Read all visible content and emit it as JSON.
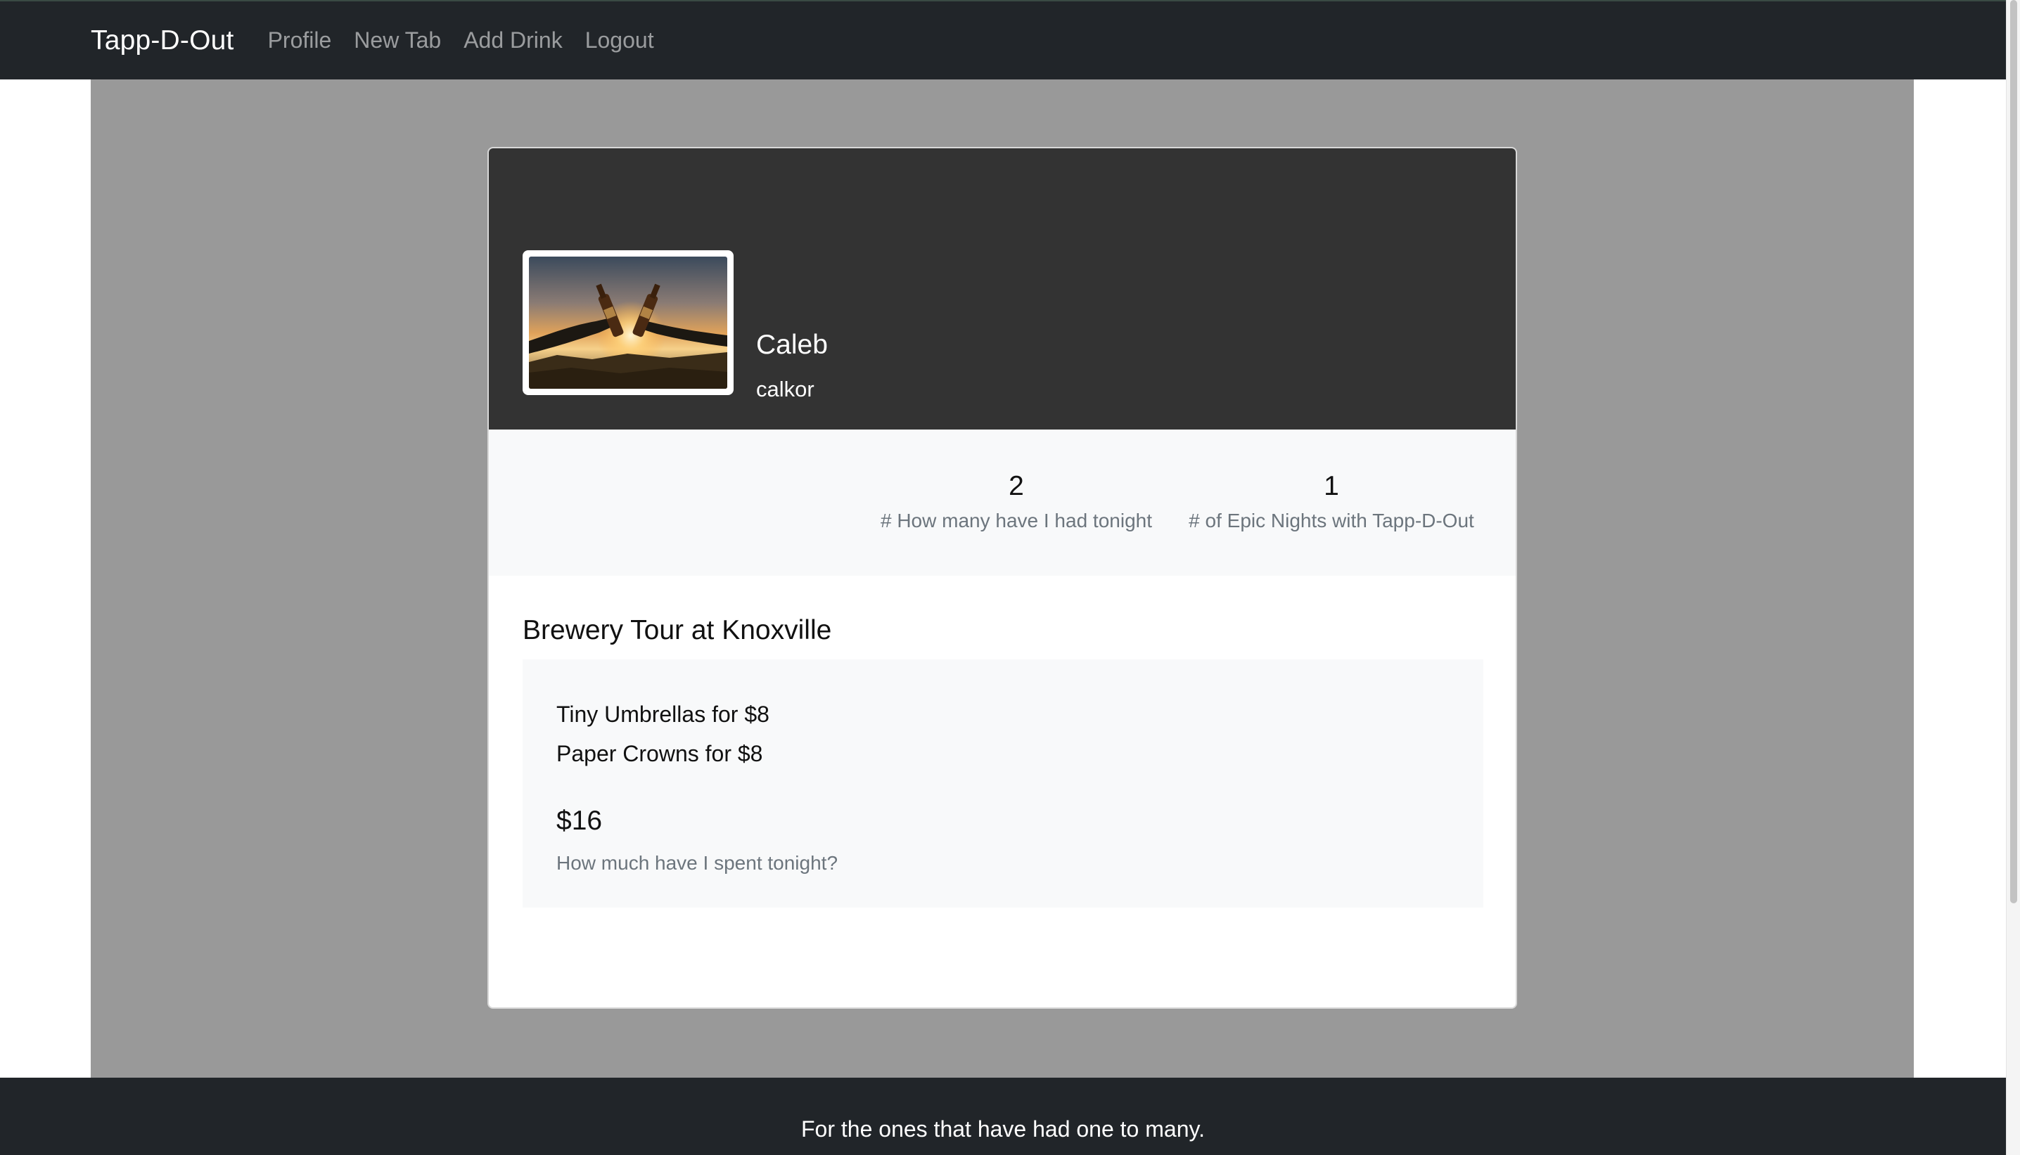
{
  "navbar": {
    "brand": "Tapp-D-Out",
    "links": [
      "Profile",
      "New Tab",
      "Add Drink",
      "Logout"
    ],
    "background": "#212529"
  },
  "profile": {
    "name": "Caleb",
    "username": "calkor",
    "avatar_icon": "beer-toast-sunset-photo",
    "header_color": "#333333"
  },
  "stats": [
    {
      "value": "2",
      "label": "# How many have I had tonight"
    },
    {
      "value": "1",
      "label": "# of Epic Nights with Tapp-D-Out"
    }
  ],
  "tab": {
    "title": "Brewery Tour at Knoxville",
    "drinks": [
      "Tiny Umbrellas for $8",
      "Paper Crowns for $8"
    ],
    "total": "$16",
    "total_label": "How much have I spent tonight?"
  },
  "footer": {
    "text": "For the ones that have had one to many."
  },
  "colors": {
    "page_gray": "#999999",
    "muted_text": "#6c757d",
    "light_panel": "#f8f9fa"
  }
}
